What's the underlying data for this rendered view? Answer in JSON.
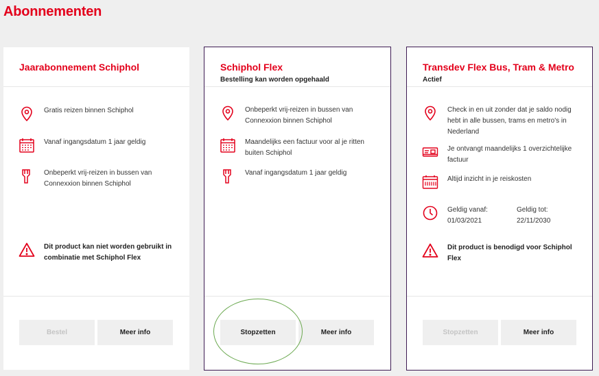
{
  "page": {
    "title": "Abonnementen"
  },
  "colors": {
    "accent": "#e3001b",
    "card_border": "#3c1a52",
    "annotation": "#6aa84f"
  },
  "cards": [
    {
      "title": "Jaarabonnement Schiphol",
      "subtitle": "",
      "features": [
        {
          "icon": "location-pin-icon",
          "text": "Gratis reizen binnen Schiphol"
        },
        {
          "icon": "calendar-icon",
          "text": "Vanaf ingangsdatum 1 jaar geldig"
        },
        {
          "icon": "bus-ticket-icon",
          "text": "Onbeperkt vrij-reizen in bussen van Connexxion binnen Schiphol"
        }
      ],
      "warning": {
        "icon": "warning-icon",
        "text": "Dit product kan niet worden gebruikt in combinatie met Schiphol Flex"
      },
      "buttons": [
        {
          "label": "Bestel",
          "enabled": false
        },
        {
          "label": "Meer info",
          "enabled": true
        }
      ]
    },
    {
      "title": "Schiphol Flex",
      "subtitle": "Bestelling kan worden opgehaald",
      "features": [
        {
          "icon": "location-pin-icon",
          "text": "Onbeperkt vrij-reizen in bussen van Connexxion binnen Schiphol"
        },
        {
          "icon": "calendar-icon",
          "text": "Maandelijks een factuur voor al je ritten buiten Schiphol"
        },
        {
          "icon": "bus-ticket-icon",
          "text": "Vanaf ingangsdatum 1 jaar geldig"
        }
      ],
      "buttons": [
        {
          "label": "Stopzetten",
          "enabled": true
        },
        {
          "label": "Meer info",
          "enabled": true
        }
      ]
    },
    {
      "title": "Transdev Flex Bus, Tram & Metro",
      "subtitle": "Actief",
      "features": [
        {
          "icon": "location-pin-icon",
          "text": "Check in en uit zonder dat je saldo nodig hebt in alle bussen, trams en metro's in Nederland"
        },
        {
          "icon": "invoice-icon",
          "text": "Je ontvangt maandelijks 1 overzichtelijke factuur"
        },
        {
          "icon": "travel-costs-icon",
          "text": "Altijd inzicht in je reiskosten"
        }
      ],
      "validity": {
        "icon": "clock-icon",
        "from_label": "Geldig vanaf:",
        "from_value": "01/03/2021",
        "to_label": "Geldig tot:",
        "to_value": "22/11/2030"
      },
      "warning": {
        "icon": "warning-icon",
        "text": "Dit product is benodigd voor Schiphol Flex"
      },
      "buttons": [
        {
          "label": "Stopzetten",
          "enabled": false
        },
        {
          "label": "Meer info",
          "enabled": true
        }
      ]
    }
  ]
}
